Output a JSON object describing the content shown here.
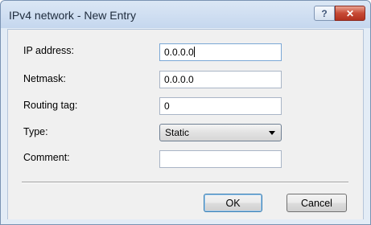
{
  "window": {
    "title": "IPv4 network - New Entry",
    "help_glyph": "?",
    "close_glyph": "✕"
  },
  "form": {
    "ip_address": {
      "label": "IP address:",
      "value": "0.0.0.0"
    },
    "netmask": {
      "label": "Netmask:",
      "value": "0.0.0.0"
    },
    "routing_tag": {
      "label": "Routing tag:",
      "value": "0"
    },
    "type": {
      "label": "Type:",
      "selected": "Static"
    },
    "comment": {
      "label": "Comment:",
      "value": ""
    }
  },
  "buttons": {
    "ok": "OK",
    "cancel": "Cancel"
  },
  "colors": {
    "close_button": "#c74a35",
    "title_bar": "#c5d7ee",
    "client_bg": "#f0f0f0"
  }
}
